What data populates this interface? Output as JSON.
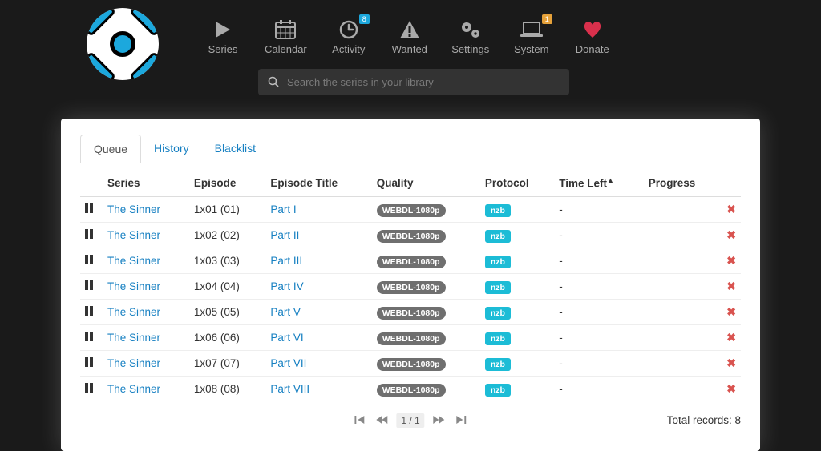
{
  "nav": {
    "series": "Series",
    "calendar": "Calendar",
    "activity": "Activity",
    "activity_badge": "8",
    "wanted": "Wanted",
    "settings": "Settings",
    "system": "System",
    "system_badge": "1",
    "donate": "Donate"
  },
  "search": {
    "placeholder": "Search the series in your library"
  },
  "tabs": {
    "queue": "Queue",
    "history": "History",
    "blacklist": "Blacklist"
  },
  "columns": {
    "series": "Series",
    "episode": "Episode",
    "title": "Episode Title",
    "quality": "Quality",
    "protocol": "Protocol",
    "timeleft": "Time Left",
    "progress": "Progress"
  },
  "rows": [
    {
      "series": "The Sinner",
      "episode": "1x01 (01)",
      "title": "Part I",
      "quality": "WEBDL-1080p",
      "protocol": "nzb",
      "timeleft": "-"
    },
    {
      "series": "The Sinner",
      "episode": "1x02 (02)",
      "title": "Part II",
      "quality": "WEBDL-1080p",
      "protocol": "nzb",
      "timeleft": "-"
    },
    {
      "series": "The Sinner",
      "episode": "1x03 (03)",
      "title": "Part III",
      "quality": "WEBDL-1080p",
      "protocol": "nzb",
      "timeleft": "-"
    },
    {
      "series": "The Sinner",
      "episode": "1x04 (04)",
      "title": "Part IV",
      "quality": "WEBDL-1080p",
      "protocol": "nzb",
      "timeleft": "-"
    },
    {
      "series": "The Sinner",
      "episode": "1x05 (05)",
      "title": "Part V",
      "quality": "WEBDL-1080p",
      "protocol": "nzb",
      "timeleft": "-"
    },
    {
      "series": "The Sinner",
      "episode": "1x06 (06)",
      "title": "Part VI",
      "quality": "WEBDL-1080p",
      "protocol": "nzb",
      "timeleft": "-"
    },
    {
      "series": "The Sinner",
      "episode": "1x07 (07)",
      "title": "Part VII",
      "quality": "WEBDL-1080p",
      "protocol": "nzb",
      "timeleft": "-"
    },
    {
      "series": "The Sinner",
      "episode": "1x08 (08)",
      "title": "Part VIII",
      "quality": "WEBDL-1080p",
      "protocol": "nzb",
      "timeleft": "-"
    }
  ],
  "pager": {
    "page": "1 / 1"
  },
  "footer": {
    "total": "Total records: 8"
  }
}
